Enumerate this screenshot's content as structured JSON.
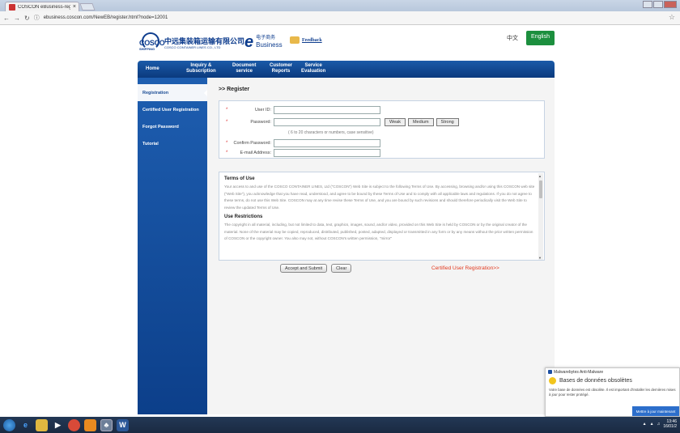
{
  "browser": {
    "tab_title": "COSCON eBusiness-reg",
    "tab_close": "×",
    "url": "ebusiness.coscon.com/NewEB/register.html?node=12001",
    "star": "☆"
  },
  "header": {
    "logo_word": "COSCO",
    "logo_sub": "SHIPPING",
    "company_zh": "中远集装箱运输有限公司",
    "company_en": "COSCO CONTAINER LINES CO., LTD",
    "ebiz_zh": "电子商务",
    "ebiz_en": "Business",
    "feedback": "Feedback",
    "lang_zh": "中文",
    "lang_en": "English"
  },
  "menu": [
    {
      "label": "Home"
    },
    {
      "label": "Inquiry &\nSubscription"
    },
    {
      "label": "Document\nservice"
    },
    {
      "label": "Customer\nReports"
    },
    {
      "label": "Service\nEvaluation"
    }
  ],
  "sidebar": {
    "items": [
      {
        "label": "Registration",
        "active": true
      },
      {
        "label": "Certified User Registration"
      },
      {
        "label": "Forgot Password"
      },
      {
        "label": "Tutorial"
      }
    ]
  },
  "register": {
    "crumb": ">> Register",
    "user_id_label": "User ID:",
    "password_label": "Password:",
    "confirm_label": "Confirm Password:",
    "email_label": "E-mail Address:",
    "required_mark": "*",
    "hint": "( 6 to 20 characters or numbers, case sensitive)",
    "strength": [
      "Weak",
      "Medium",
      "Strong"
    ]
  },
  "terms": {
    "heading1": "Terms of Use",
    "para1": "Your access to and use of the COSCO CONTAINER LINES, Ltd (\"COSCON\") Web Site is subject to the following Terms of Use. By accessing, browsing and/or using this COSCON web site (\"Web Site\"), you acknowledge that you have read, understood, and agree to be bound by these Terms of Use and to comply with all applicable laws and regulations. If you do not agree to these terms, do not use this Web Site. COSCON may at any time revise these Terms of Use, and you are bound by such revisions and should therefore periodically visit the Web Site to review the updated Terms of Use.",
    "heading2": "Use Restrictions",
    "para2": "The copyright in all material, including, but not limited to data, text, graphics, images, sound, and/or video, provided on this Web Site is held by COSCON or by the original creator of the material. None of the material may be copied, reproduced, distributed, published, posted, adapted, displayed or transmitted in any form or by any means without the prior written permission of COSCON or the copyright owner. You also may not, without COSCON's written permission, \"mirror\""
  },
  "actions": {
    "accept": "Accept and Submit",
    "clear": "Clear",
    "certified_link": "Certified User Registration>>"
  },
  "toast": {
    "app": "Malwarebytes Anti-Malware",
    "title": "Bases de données obsolètes",
    "message": "Votre base de données est obsolète. Il est important d'installer les dernières mises à jour pour rester protégé.",
    "button": "Mettre à jour maintenant"
  },
  "taskbar": {
    "time": "13:46",
    "date": "16/01/2"
  }
}
